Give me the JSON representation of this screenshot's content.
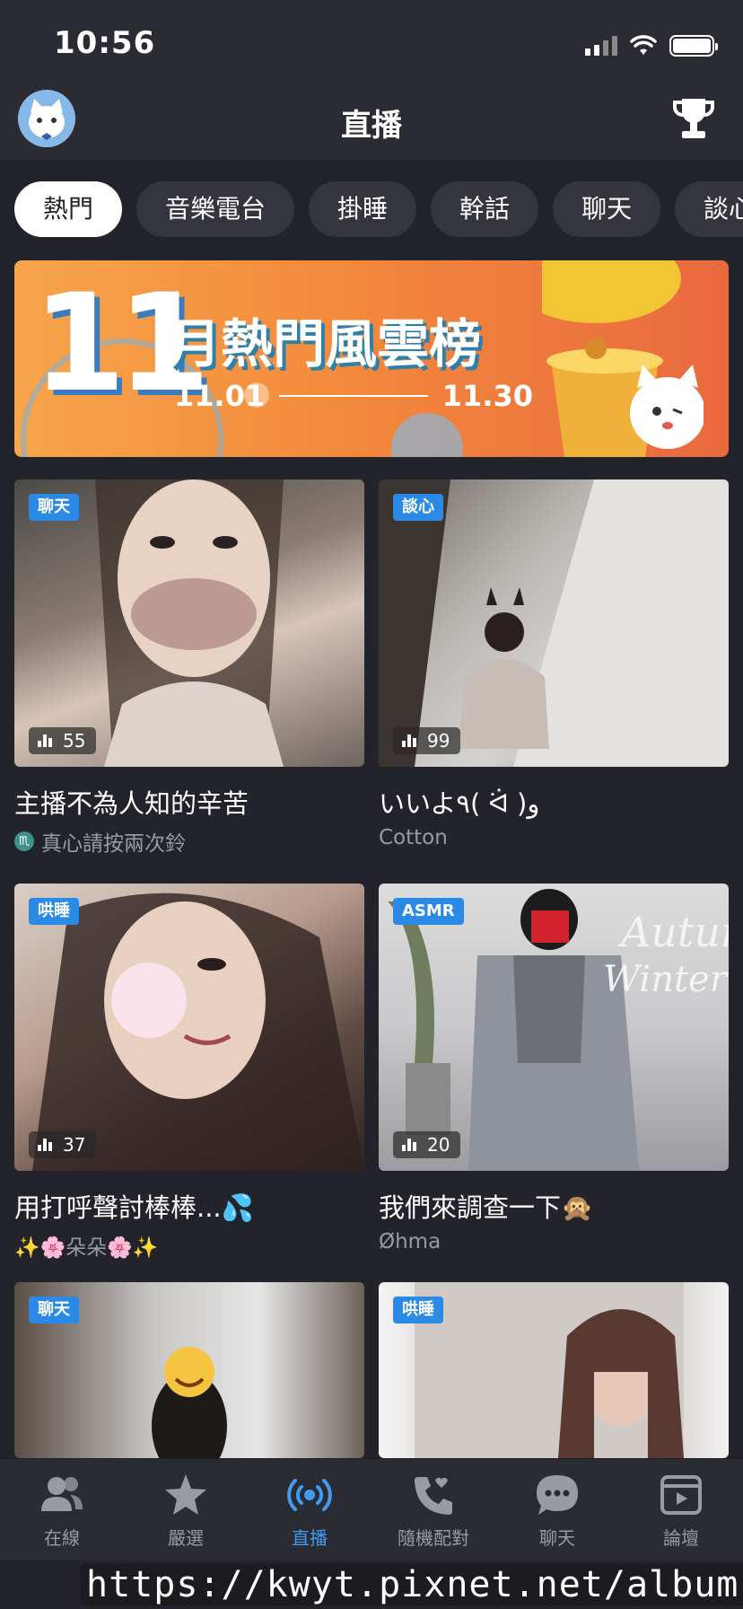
{
  "status_bar": {
    "time": "10:56"
  },
  "header": {
    "title": "直播"
  },
  "tabs": [
    {
      "label": "熱門"
    },
    {
      "label": "音樂電台"
    },
    {
      "label": "掛睡"
    },
    {
      "label": "幹話"
    },
    {
      "label": "聊天"
    },
    {
      "label": "談心"
    }
  ],
  "banner": {
    "month": "11",
    "title": "月熱門風雲榜",
    "start": "11.01",
    "end": "11.30"
  },
  "cards": [
    {
      "tag": "聊天",
      "viewers": "55",
      "title": "主播不為人知的辛苦",
      "subtitle": "真心請按兩次鈴",
      "zodiac": "♏"
    },
    {
      "tag": "談心",
      "viewers": "99",
      "title": "いいよ٩( ᐛ )و",
      "subtitle": "Cotton"
    },
    {
      "tag": "哄睡",
      "viewers": "37",
      "title": "用打呼聲討棒棒...💦",
      "subtitle": "✨🌸朵朵🌸✨"
    },
    {
      "tag": "ASMR",
      "viewers": "20",
      "title": "我們來調查一下🙊",
      "subtitle": "Øhma"
    },
    {
      "tag": "聊天"
    },
    {
      "tag": "哄睡"
    }
  ],
  "bottom_nav": [
    {
      "label": "在線",
      "icon": "people-icon"
    },
    {
      "label": "嚴選",
      "icon": "star-icon"
    },
    {
      "label": "直播",
      "icon": "broadcast-icon",
      "active": true
    },
    {
      "label": "隨機配對",
      "icon": "phone-heart-icon"
    },
    {
      "label": "聊天",
      "icon": "chat-bubble-icon"
    },
    {
      "label": "論壇",
      "icon": "forum-play-icon"
    }
  ],
  "watermark": "https://kwyt.pixnet.net/album",
  "colors": {
    "accent": "#3f9cf0",
    "tag": "#2b8ae6",
    "background": "#23232b"
  }
}
